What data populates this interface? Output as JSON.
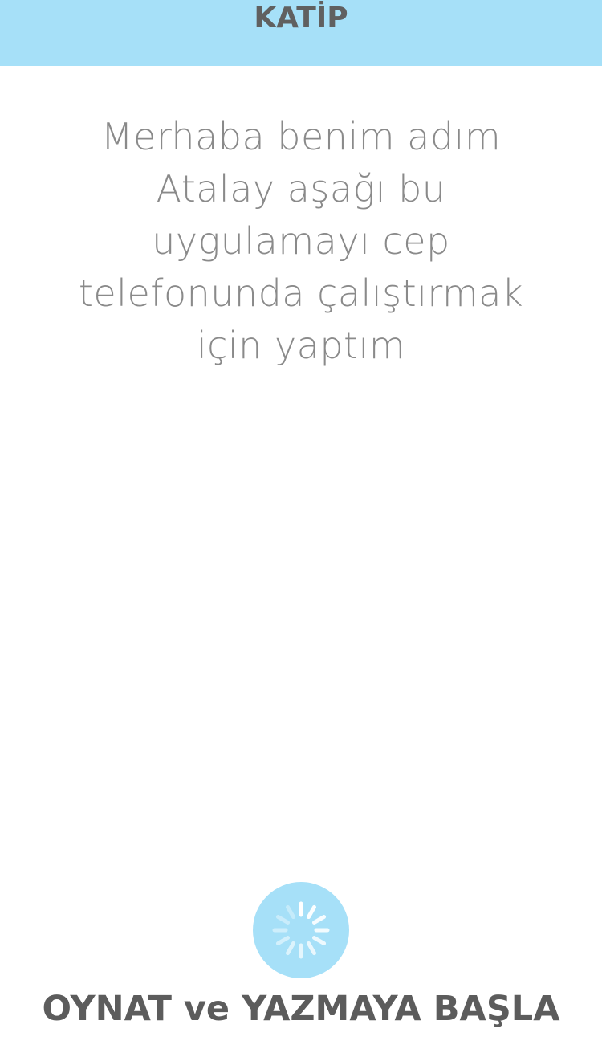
{
  "header": {
    "title": "KATİP"
  },
  "intro": {
    "text": "Merhaba benim adım Atalay aşağı bu uygulamayı cep telefonunda çalıştırmak için yaptım"
  },
  "play_button": {
    "icon": "loading-spinner-icon"
  },
  "cta": {
    "label": "OYNAT ve YAZMAYA BAŞLA"
  },
  "colors": {
    "accent": "#a6e0f8",
    "header_text": "#606060",
    "intro_text": "#8a8a8a",
    "cta_text": "#5c5c5c"
  }
}
